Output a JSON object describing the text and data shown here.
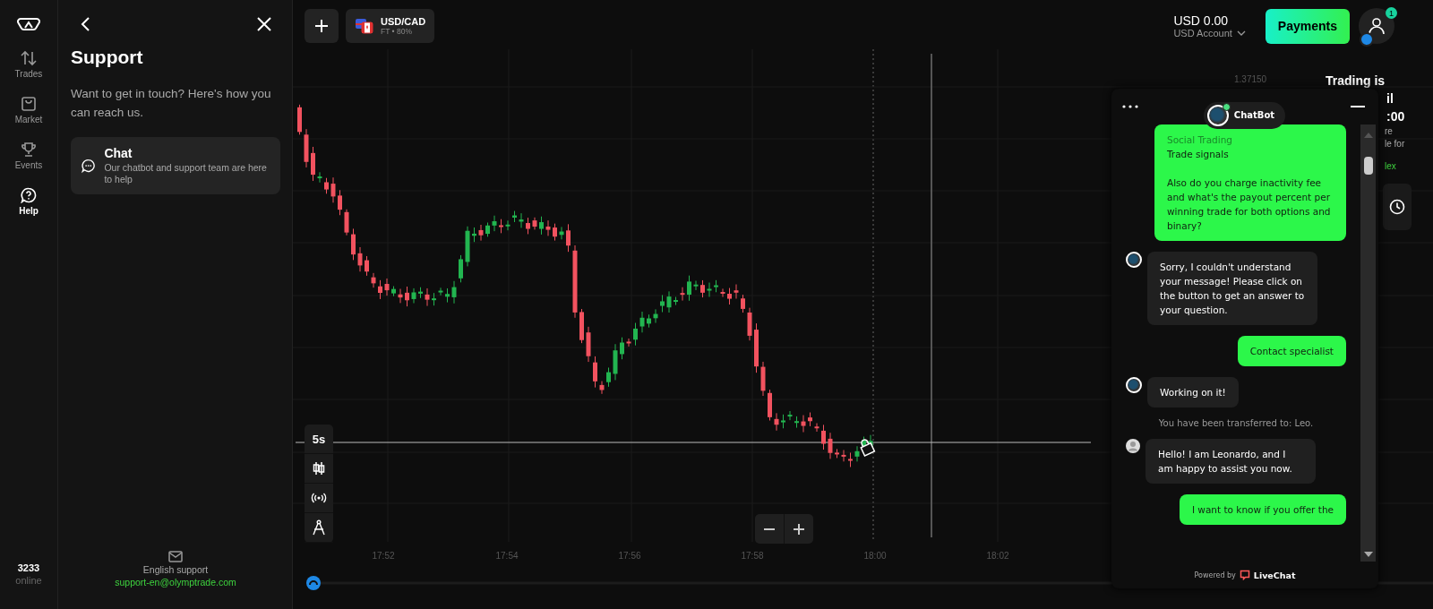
{
  "nav": {
    "items": [
      {
        "label": "Trades",
        "selected": false
      },
      {
        "label": "Market",
        "selected": false
      },
      {
        "label": "Events",
        "selected": false
      },
      {
        "label": "Help",
        "selected": true
      }
    ],
    "online_count": "3233",
    "online_label": "online"
  },
  "support_panel": {
    "title": "Support",
    "intro": "Want to get in touch? Here's how you can reach us.",
    "options": [
      {
        "title": "Chat",
        "description": "Our chatbot and support team are here to help"
      }
    ],
    "email_label": "English support",
    "email": "support-en@olymptrade.com"
  },
  "top_bar": {
    "asset": {
      "name": "USD/CAD",
      "details": "FT • 80%"
    },
    "balance": "USD 0.00",
    "account": "USD Account",
    "payments_button": "Payments",
    "notification_count": "1"
  },
  "chart": {
    "price_label": "1.37150",
    "timeframe": "5s",
    "time_labels": [
      "17:52",
      "17:54",
      "17:56",
      "17:58",
      "18:00",
      "18:02"
    ]
  },
  "side_panel": {
    "title_lines": [
      "Trading is",
      "il",
      ":00"
    ],
    "text_lines": [
      "re",
      "le for"
    ],
    "link": "lex"
  },
  "chat": {
    "title": "ChatBot",
    "messages": [
      {
        "kind": "user",
        "faded_text": "Social Trading",
        "text": "Trade signals\n\nAlso do you charge inactivity fee and what's the payout percent per winning trade for both options and binary?"
      },
      {
        "kind": "bot",
        "text": "Sorry, I couldn't understand your message! Please click on the button to get an answer to your question."
      },
      {
        "kind": "user",
        "text": "Contact specialist"
      },
      {
        "kind": "bot",
        "text": "Working on it!"
      },
      {
        "kind": "system",
        "text": "You have been transferred to: Leo."
      },
      {
        "kind": "agent",
        "text": "Hello! I am Leonardo, and I am happy to assist you now."
      },
      {
        "kind": "user",
        "text": "I want to know if you offer the"
      }
    ],
    "footer_prefix": "Powered by",
    "footer_brand": "LiveChat"
  }
}
